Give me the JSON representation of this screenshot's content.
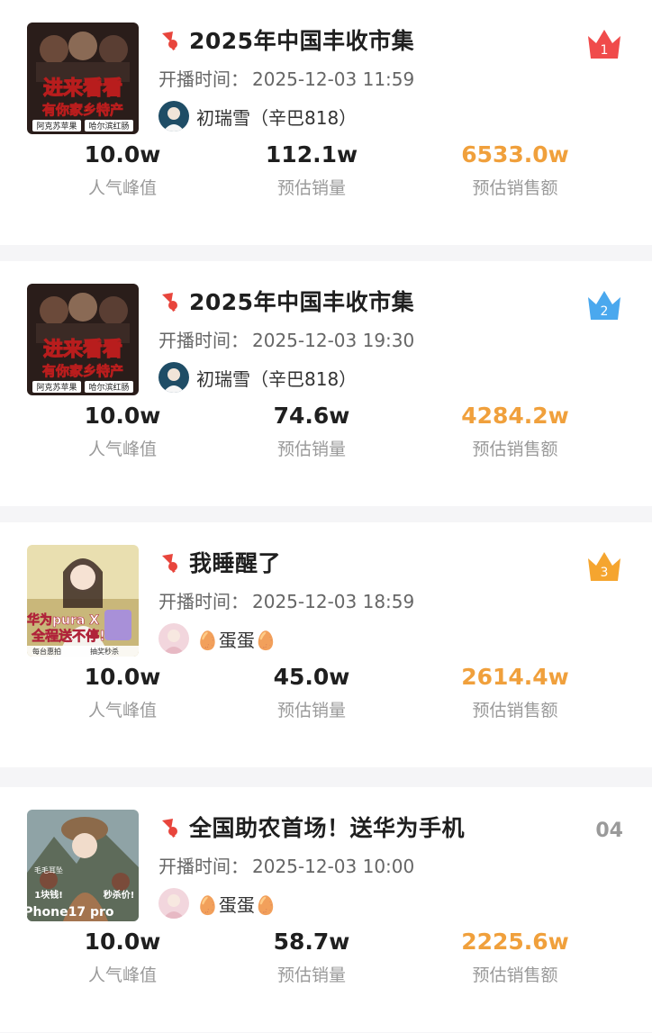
{
  "labels": {
    "start_time": "开播时间：",
    "peak": "人气峰值",
    "est_volume": "预估销量",
    "est_sales": "预估销售额"
  },
  "cards": [
    {
      "title": "2025年中国丰收市集",
      "start_time": "2025-12-03 11:59",
      "host": "初瑞雪（辛巴818）",
      "rank": "1",
      "rank_badge_color": "#f04b4b",
      "thumb_text": [
        "进来看看",
        "有你家乡特产",
        "阿克苏苹果",
        "哈尔滨红肠"
      ],
      "peak": "10.0w",
      "volume": "112.1w",
      "sales": "6533.0w"
    },
    {
      "title": "2025年中国丰收市集",
      "start_time": "2025-12-03 19:30",
      "host": "初瑞雪（辛巴818）",
      "rank": "2",
      "rank_badge_color": "#4aa8ee",
      "thumb_text": [
        "进来看看",
        "有你家乡特产",
        "阿克苏苹果",
        "哈尔滨红肠"
      ],
      "peak": "10.0w",
      "volume": "74.6w",
      "sales": "4284.2w"
    },
    {
      "title": "我睡醒了",
      "start_time": "2025-12-03 18:59",
      "host": "🥚蛋蛋🥚",
      "rank": "3",
      "rank_badge_color": "#f5a52f",
      "thumb_text": [
        "华为pura X",
        "全程送不停!",
        "每台惠拍",
        "抽奖秒杀"
      ],
      "peak": "10.0w",
      "volume": "45.0w",
      "sales": "2614.4w"
    },
    {
      "title": "全国助农首场！送华为手机",
      "start_time": "2025-12-03 10:00",
      "host": "🥚蛋蛋🥚",
      "rank": "04",
      "rank_badge_color": "",
      "thumb_text": [
        "毛毛耳坠",
        "1块钱!",
        "秒杀价!",
        "iPhone17 pro"
      ],
      "peak": "10.0w",
      "volume": "58.7w",
      "sales": "2225.6w"
    }
  ]
}
